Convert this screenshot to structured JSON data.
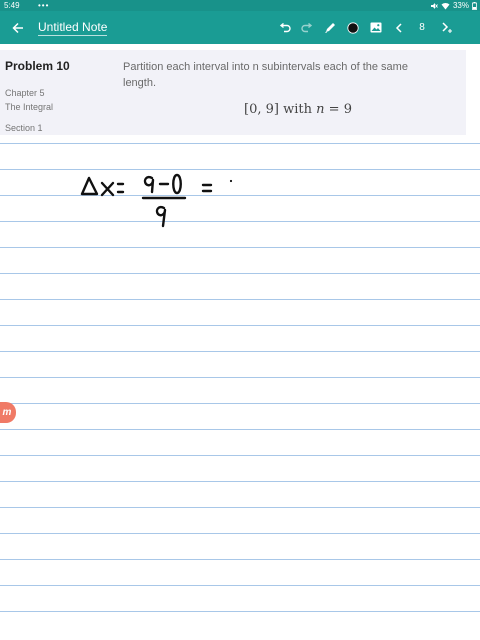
{
  "status_bar": {
    "time": "5:49",
    "dots": "•••",
    "battery": "33%"
  },
  "app_bar": {
    "title": "Untitled Note",
    "page_number": "8",
    "icons": [
      "back-arrow-icon",
      "undo-icon",
      "redo-icon",
      "pen-icon",
      "color-dot-icon",
      "image-icon",
      "chevron-left-icon",
      "chevron-right-plus-icon"
    ],
    "pen_color": "#111111"
  },
  "problem": {
    "title": "Problem 10",
    "chapter": "Chapter 5",
    "chapter_title": "The Integral",
    "section": "Section 1",
    "text": "Partition each interval into n subintervals each of the same length.",
    "math_interval": "[0, 9]",
    "math_with": "with",
    "math_n": "n",
    "math_eq": "=",
    "math_value": "9"
  },
  "handwriting": {
    "expression": "Δx = (9 - 0) / 9 =",
    "ink_color": "#111111"
  },
  "side_tab": {
    "label": "m",
    "color": "#f07a66"
  },
  "colors": {
    "accent": "#1a9c94",
    "status_bar": "#18928a",
    "ruled_line": "#a8c7e8",
    "card_background": "#f2f2f8"
  }
}
